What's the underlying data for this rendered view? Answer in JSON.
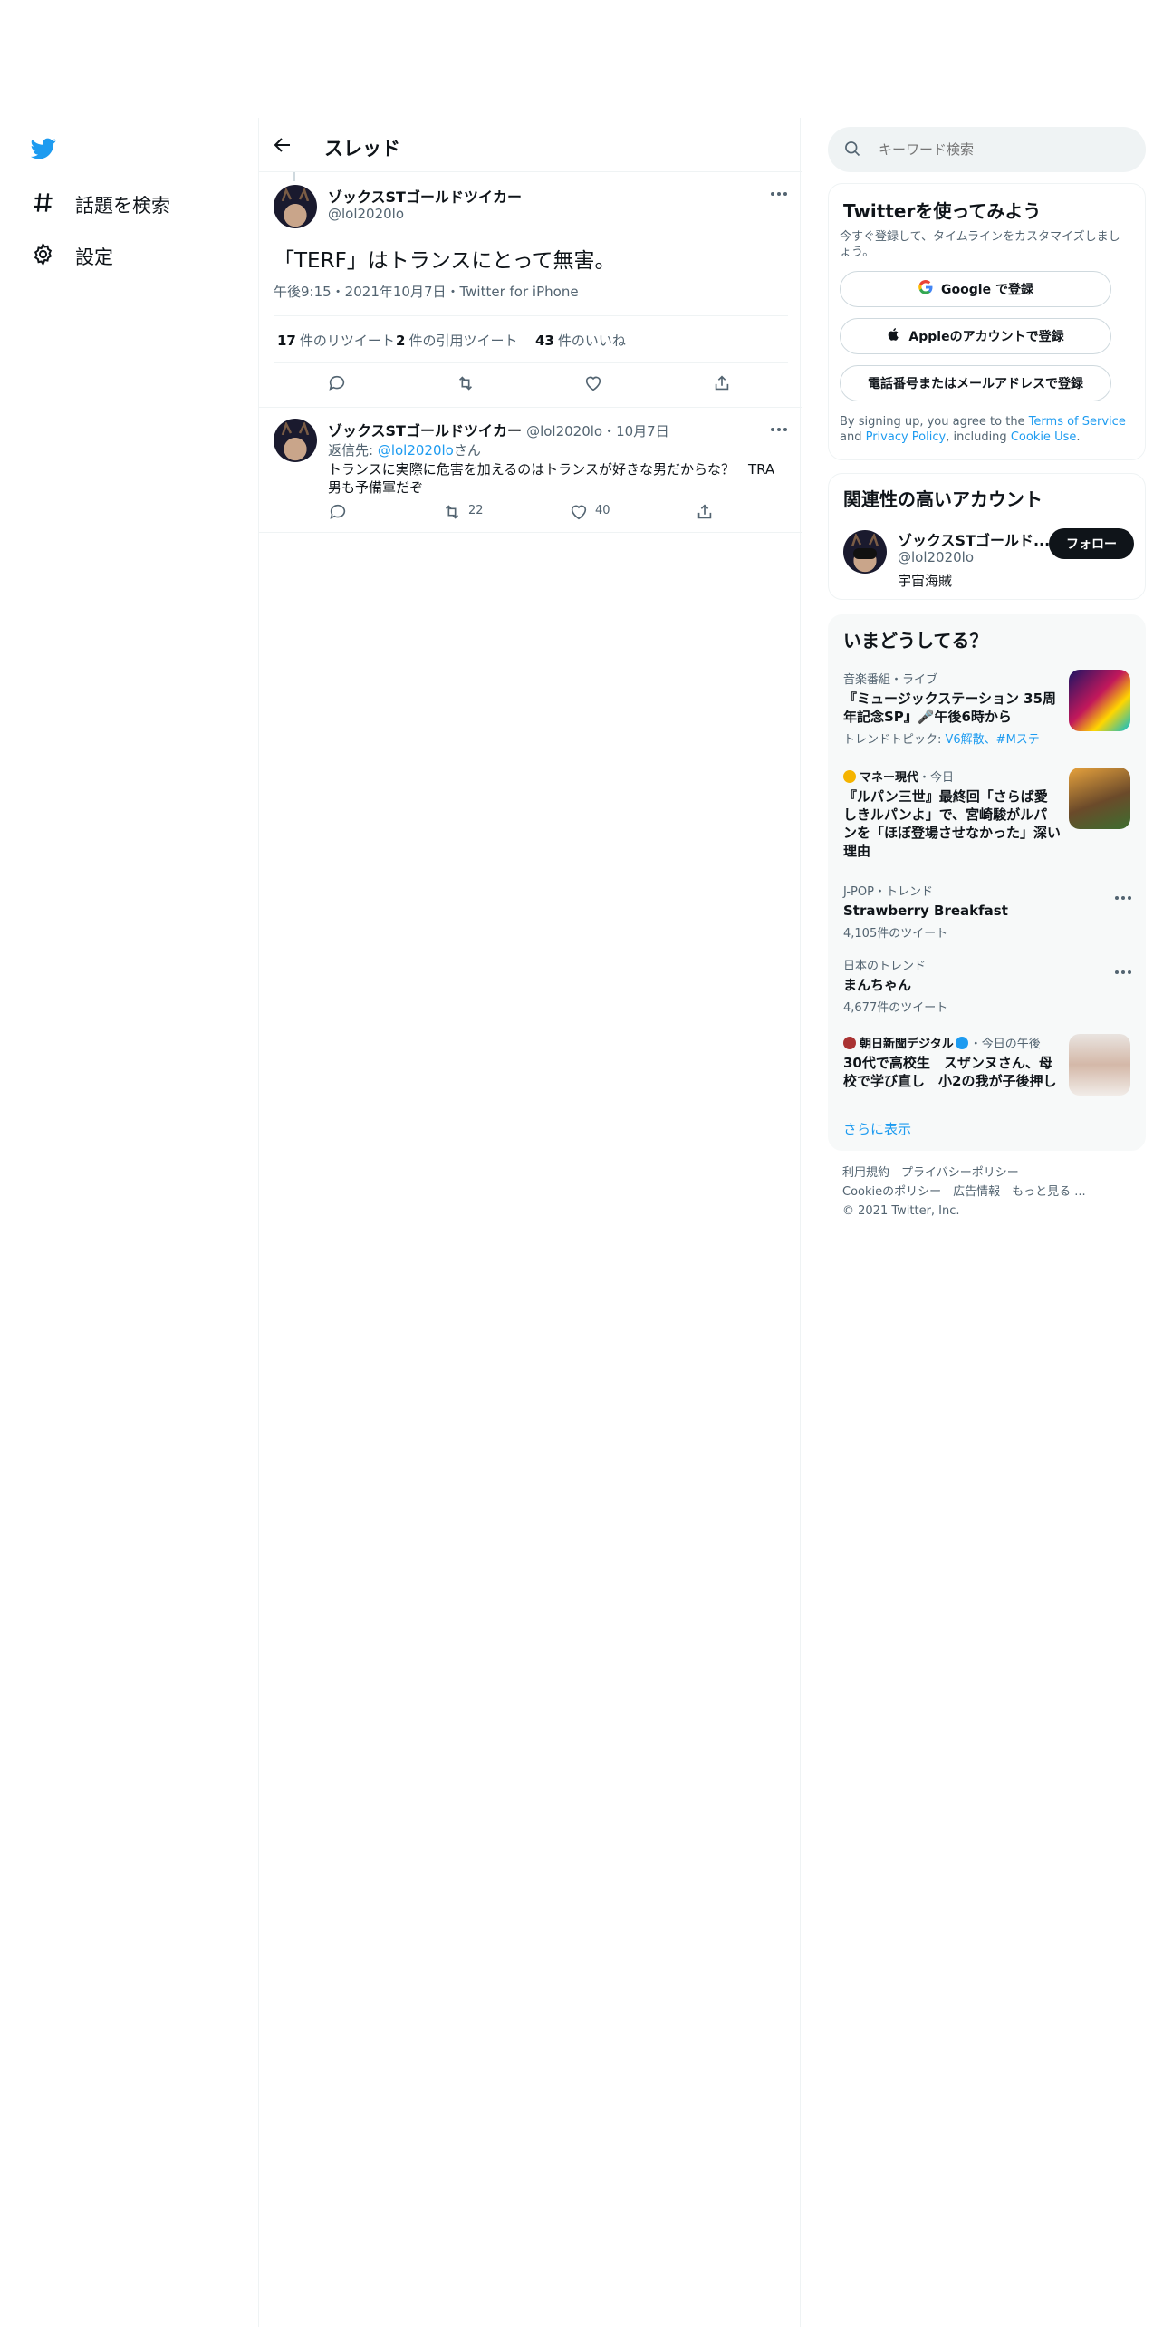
{
  "nav": {
    "items": [
      {
        "label": "話題を検索",
        "icon": "hashtag-icon"
      },
      {
        "label": "設定",
        "icon": "gear-icon"
      }
    ]
  },
  "thread": {
    "title": "スレッド",
    "main_tweet": {
      "name": "ゾックスSTゴールドツイカー",
      "handle": "@lol2020lo",
      "text": "「TERF」はトランスにとって無害。",
      "timestamp": "午後9:15・2021年10月7日・Twitter for iPhone",
      "retweets": {
        "count": "17",
        "label": "件のリツイート"
      },
      "quotes": {
        "count": "2",
        "label": "件の引用ツイート"
      },
      "likes": {
        "count": "43",
        "label": "件のいいね"
      }
    },
    "reply": {
      "name": "ゾックスSTゴールドツイカー",
      "handle_date": "@lol2020lo・10月7日",
      "reply_prefix": "返信先: ",
      "reply_to": "@lol2020lo",
      "reply_suffix": "さん",
      "text": "トランスに実際に危害を加えるのはトランスが好きな男だからな？　TRA男も予備軍だぞ",
      "retweets": "22",
      "likes": "40"
    }
  },
  "search": {
    "placeholder": "キーワード検索"
  },
  "signup": {
    "title": "Twitterを使ってみよう",
    "subtitle": "今すぐ登録して、タイムラインをカスタマイズしましょう。",
    "google": "Google で登録",
    "apple": "Appleのアカウントで登録",
    "phone": "電話番号またはメールアドレスで登録",
    "terms_prefix": "By signing up, you agree to the ",
    "terms_link": "Terms of Service",
    "terms_and": " and ",
    "privacy_link": "Privacy Policy",
    "terms_including": ", including ",
    "cookie_link": "Cookie Use",
    "terms_end": "."
  },
  "related": {
    "title": "関連性の高いアカウント",
    "name": "ゾックスSTゴールド...",
    "handle": "@lol2020lo",
    "bio": "宇宙海賊",
    "follow": "フォロー"
  },
  "trends": {
    "title": "いまどうしてる？",
    "items": [
      {
        "meta": "音楽番組・ライブ",
        "title": "『ミュージックステーション 35周年記念SP』🎤午後6時から",
        "sub_prefix": "トレンドトピック: ",
        "sub_links": "V6解散、#Mステ"
      },
      {
        "source": "マネー現代",
        "meta": "・今日",
        "title": "『ルパン三世』最終回「さらば愛しきルパンよ」で、宮崎駿がルパンを「ほぼ登場させなかった」深い理由"
      },
      {
        "meta": "J-POP・トレンド",
        "title": "Strawberry Breakfast",
        "sub": "4,105件のツイート"
      },
      {
        "meta": "日本のトレンド",
        "title": "まんちゃん",
        "sub": "4,677件のツイート"
      },
      {
        "source": "朝日新聞デジタル",
        "meta": "・今日の午後",
        "title": "30代で高校生　スザンヌさん、母校で学び直し　小2の我が子後押し"
      }
    ],
    "show_more": "さらに表示"
  },
  "footer": {
    "line1": "利用規約　プライバシーポリシー",
    "line2": "Cookieのポリシー　広告情報　もっと見る ...",
    "line3": "© 2021 Twitter, Inc."
  },
  "colors": {
    "accent": "#1d9bf0",
    "text": "#0f1419",
    "muted": "#536471",
    "border": "#eff3f4"
  }
}
